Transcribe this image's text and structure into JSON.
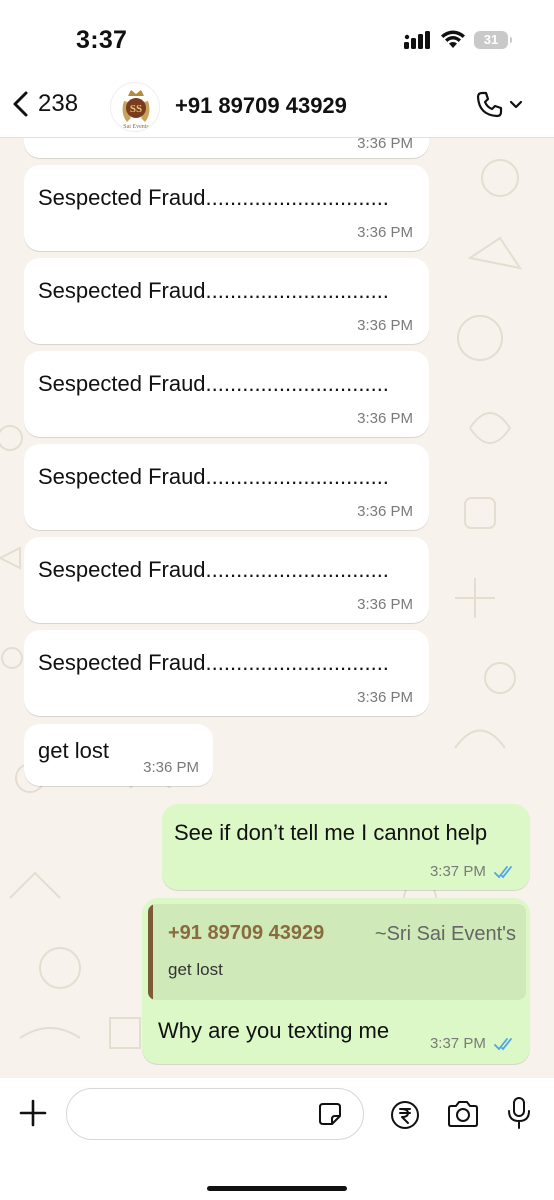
{
  "status_bar": {
    "time": "3:37",
    "battery": "31"
  },
  "header": {
    "back_count": "238",
    "contact_name": "+91 89709 43929",
    "avatar_logo": "SS Sai Events"
  },
  "messages": [
    {
      "direction": "in",
      "text": "Sespected Fraud..............................",
      "time": "3:36 PM"
    },
    {
      "direction": "in",
      "text": "Sespected Fraud..............................",
      "time": "3:36 PM"
    },
    {
      "direction": "in",
      "text": "Sespected Fraud..............................",
      "time": "3:36 PM"
    },
    {
      "direction": "in",
      "text": "Sespected Fraud..............................",
      "time": "3:36 PM"
    },
    {
      "direction": "in",
      "text": "Sespected Fraud..............................",
      "time": "3:36 PM"
    },
    {
      "direction": "in",
      "text": "Sespected Fraud..............................",
      "time": "3:36 PM"
    },
    {
      "direction": "in",
      "text": "get lost",
      "time": "3:36 PM"
    },
    {
      "direction": "out",
      "text": "See if don’t tell me I cannot help",
      "time": "3:37 PM",
      "status": "read"
    },
    {
      "direction": "out",
      "text": "Why are you texting me",
      "time": "3:37 PM",
      "status": "read",
      "quote": {
        "name": "+91 89709 43929",
        "push_name": "~Sri Sai Event's",
        "text": "get lost"
      }
    }
  ],
  "partial_top_message": {
    "time": "3:36 PM"
  },
  "input": {
    "placeholder": ""
  },
  "colors": {
    "outgoing_bubble": "#dcf8c6",
    "incoming_bubble": "#ffffff",
    "chat_background": "#f7f3ec",
    "read_ticks": "#4fa6e8",
    "quote_accent": "#7b5a35"
  },
  "icons": [
    "back-chevron-icon",
    "phone-icon",
    "chevron-down-icon",
    "plus-icon",
    "sticker-icon",
    "rupee-icon",
    "camera-icon",
    "mic-icon",
    "double-check-icon"
  ]
}
